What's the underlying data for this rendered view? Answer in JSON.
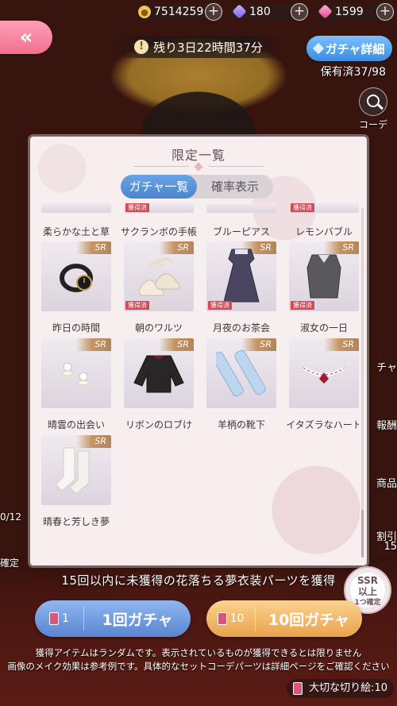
{
  "currencies": [
    {
      "icon": "gold-coin-icon",
      "value": "7514259"
    },
    {
      "icon": "purple-diamond-icon",
      "value": "180"
    },
    {
      "icon": "pink-diamond-icon",
      "value": "1599"
    }
  ],
  "header": {
    "back_icon": "double-chevron-left-icon",
    "timer": "残り3日22時間37分",
    "detail_label": "ガチャ詳細",
    "owned": "保有済37/98",
    "coordinate_label": "コーデ"
  },
  "modal": {
    "title": "限定一覧",
    "tabs": [
      {
        "label": "ガチャ一覧",
        "active": true
      },
      {
        "label": "確率表示",
        "active": false
      }
    ],
    "obtained_badge": "獲得済",
    "rarity": "SR",
    "partial_row": [
      {
        "name": "柔らかな土と草",
        "obtained": false
      },
      {
        "name": "サクランボの手帳",
        "obtained": true
      },
      {
        "name": "ブルーピアス",
        "obtained": false
      },
      {
        "name": "レモンバブル",
        "obtained": true
      }
    ],
    "items": [
      {
        "name": "昨日の時間",
        "obtained": false,
        "icon": "watch-icon"
      },
      {
        "name": "朝のワルツ",
        "obtained": true,
        "icon": "heels-icon"
      },
      {
        "name": "月夜のお茶会",
        "obtained": true,
        "icon": "dress-icon"
      },
      {
        "name": "淑女の一日",
        "obtained": true,
        "icon": "blouse-icon"
      },
      {
        "name": "晴雲の出会い",
        "obtained": false,
        "icon": "earrings-icon"
      },
      {
        "name": "リボンのロブけ",
        "obtained": false,
        "icon": "sweater-icon"
      },
      {
        "name": "羊柄の靴下",
        "obtained": false,
        "icon": "socks-icon"
      },
      {
        "name": "イタズラなハート",
        "obtained": false,
        "icon": "choker-icon"
      },
      {
        "name": "晴春と芳しき夢",
        "obtained": false,
        "icon": "stockings-icon"
      }
    ]
  },
  "side": {
    "right_1": "チャ",
    "right_2": "報酬",
    "right_3": "商品",
    "right_4": "割引",
    "right_5": "15",
    "left_1": "0/12",
    "left_2": "確定"
  },
  "promo": "15回以内に未獲得の花落ちる夢衣装パーツを獲得",
  "ssr_badge": {
    "line1": "SSR",
    "line2": "以上",
    "line3": "1つ確定"
  },
  "gacha": {
    "single": {
      "cost": "1",
      "label": "1回ガチャ"
    },
    "ten": {
      "cost": "10",
      "label": "10回ガチャ"
    }
  },
  "disclaimer": [
    "獲得アイテムはランダムです。表示されているものが獲得できるとは限りません",
    "画像のメイク効果は参考例です。具体的なセットコーデパーツは詳細ページをご確認ください"
  ],
  "cut_items": "大切な切り絵:10",
  "colors": {
    "accent_pink": "#f1708f",
    "tab_blue": "#4a84cf",
    "badge_red": "#d24a56",
    "gold_button": "#e9a24d"
  }
}
